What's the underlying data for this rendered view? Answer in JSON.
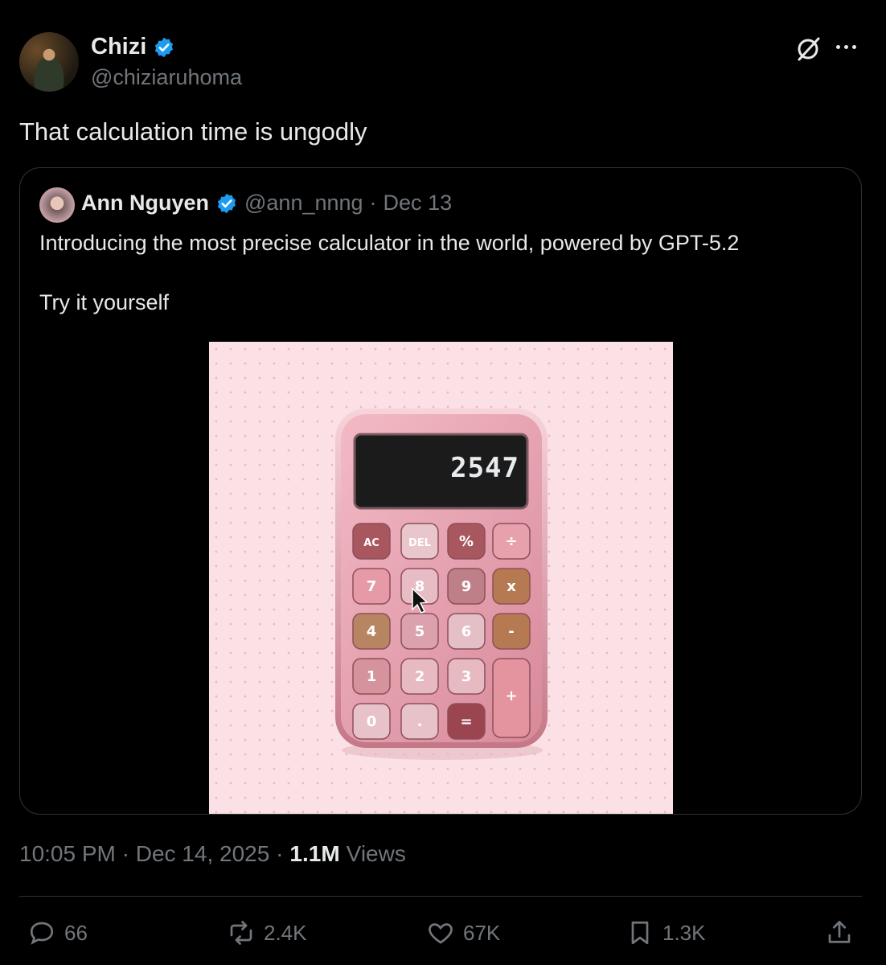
{
  "post": {
    "author": {
      "name": "Chizi",
      "handle": "@chiziaruhoma",
      "verified": true
    },
    "text": "That calculation time is ungodly",
    "timestamp": "10:05 PM · Dec 14, 2025 ·",
    "views_count": "1.1M",
    "views_label": "Views"
  },
  "quoted": {
    "author": {
      "name": "Ann Nguyen",
      "handle": "@ann_nnng",
      "verified": true
    },
    "separator": "·",
    "date": "Dec 13",
    "text_line1": "Introducing the most precise calculator in the world, powered by GPT-5.2",
    "text_line2": "Try it yourself",
    "media": {
      "display": "2547",
      "keys": [
        "AC",
        "DEL",
        "%",
        "÷",
        "7",
        "8",
        "9",
        "x",
        "4",
        "5",
        "6",
        "-",
        "1",
        "2",
        "3",
        "+",
        "0",
        ".",
        "="
      ]
    }
  },
  "actions": {
    "replies": "66",
    "reposts": "2.4K",
    "likes": "67K",
    "bookmarks": "1.3K"
  },
  "icons": [
    "verified-badge-icon",
    "grok-icon",
    "more-icon",
    "reply-icon",
    "repost-icon",
    "like-icon",
    "bookmark-icon",
    "share-icon"
  ],
  "colors": {
    "background": "#000000",
    "text": "#e7e9ea",
    "muted": "#71767b",
    "verified": "#1d9bf0",
    "border": "#2f3336"
  }
}
